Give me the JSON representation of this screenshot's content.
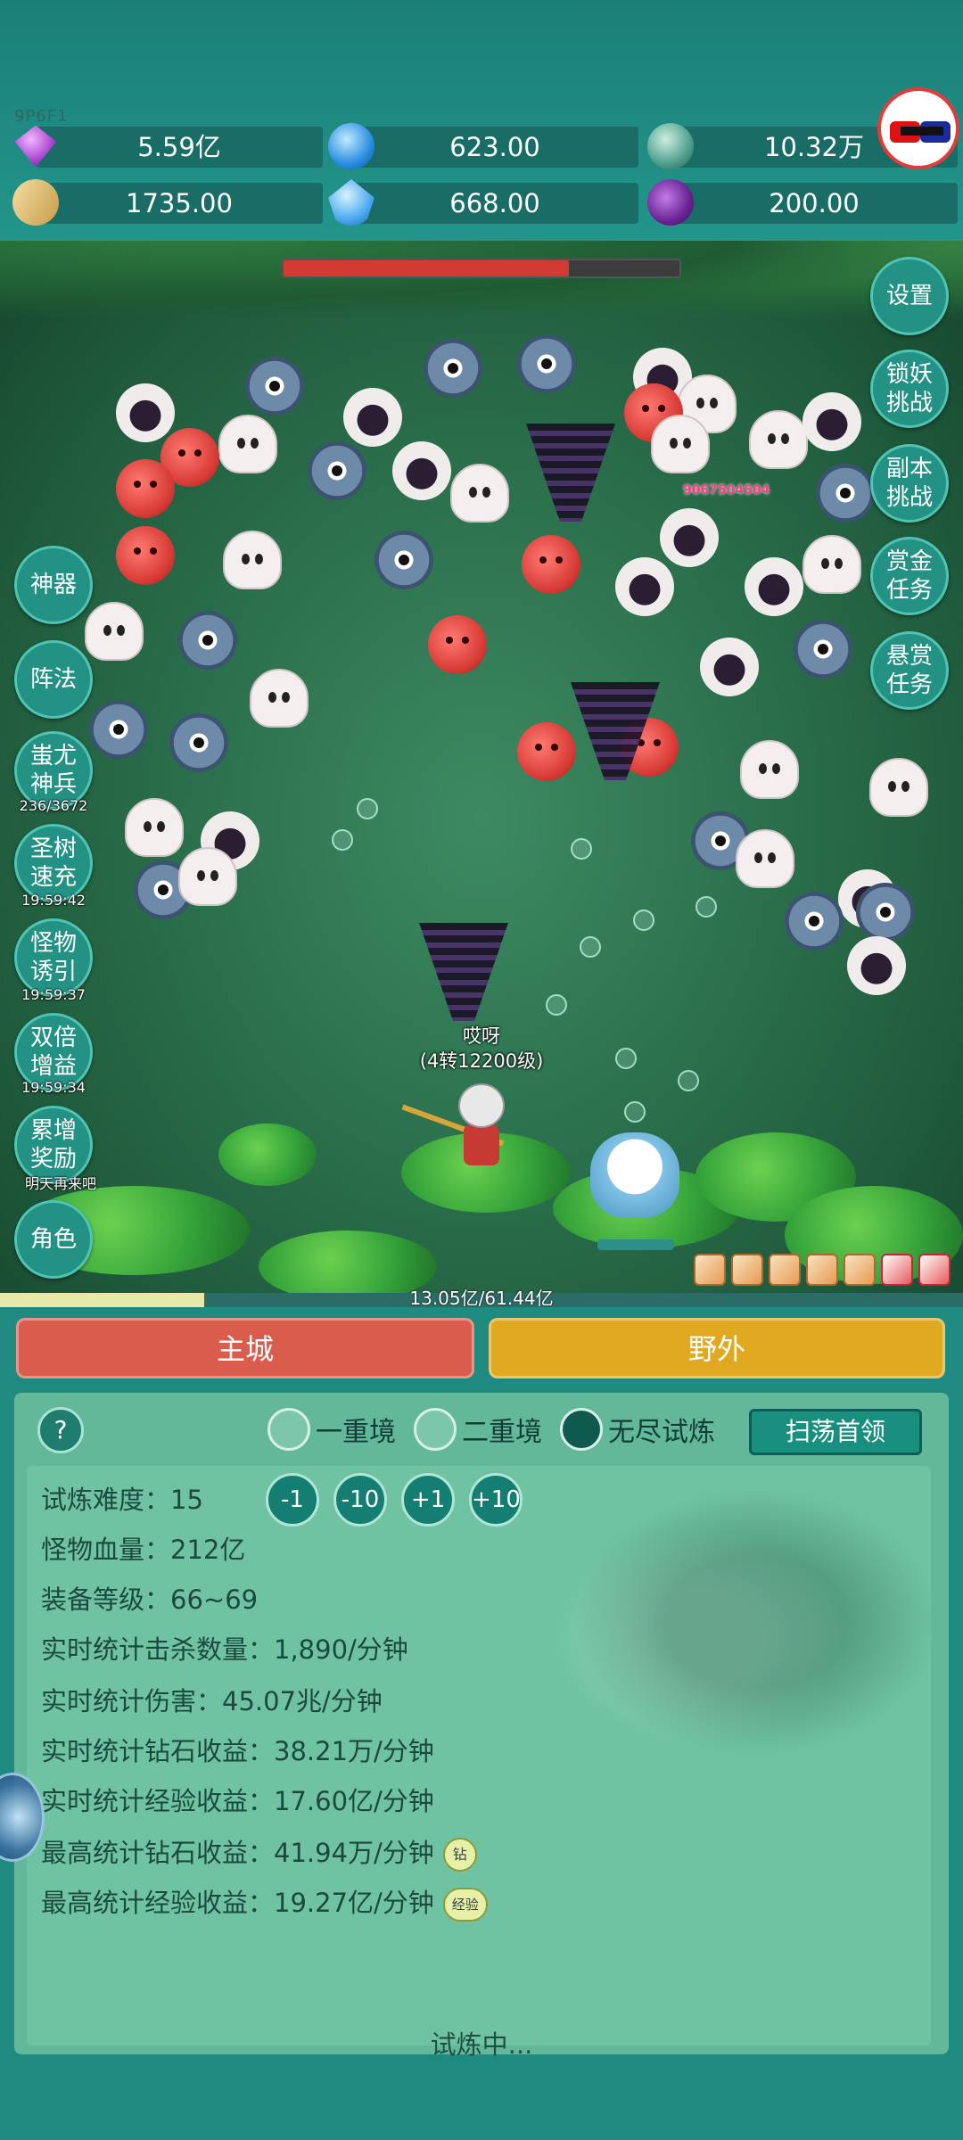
{
  "user_code": "9P6F1",
  "resources": [
    {
      "icon": "diamond-icon",
      "value": "5.59亿"
    },
    {
      "icon": "sapphire-icon",
      "value": "623.00"
    },
    {
      "icon": "orb-icon",
      "value": "10.32万"
    },
    {
      "icon": "scroll-icon",
      "value": "1735.00"
    },
    {
      "icon": "crystal-icon",
      "value": "668.00"
    },
    {
      "icon": "potion-pot-icon",
      "value": "200.00"
    }
  ],
  "boss_hp_fraction": 0.72,
  "left_menu": [
    {
      "label": "神器",
      "sub": ""
    },
    {
      "label": "阵法",
      "sub": ""
    },
    {
      "label": "蚩尤神兵",
      "sub": "236/3672"
    },
    {
      "label": "圣树速充",
      "sub": "19:59:42"
    },
    {
      "label": "怪物诱引",
      "sub": "19:59:37"
    },
    {
      "label": "双倍增益",
      "sub": "19:59:34"
    },
    {
      "label": "累增奖励",
      "sub": "明天再来吧"
    },
    {
      "label": "角色",
      "sub": ""
    }
  ],
  "right_menu": [
    {
      "label": "设置"
    },
    {
      "label": "锁妖挑战"
    },
    {
      "label": "副本挑战"
    },
    {
      "label": "赏金任务"
    },
    {
      "label": "悬赏任务"
    }
  ],
  "damage_number": "9067504504",
  "player": {
    "name": "哎呀",
    "level": "(4转12200级)"
  },
  "exp": {
    "text": "13.05亿/61.44亿",
    "fraction": 0.2124
  },
  "tabs": {
    "city": "主城",
    "wild": "野外"
  },
  "panel": {
    "help": "?",
    "modes": [
      {
        "label": "一重境",
        "selected": false
      },
      {
        "label": "二重境",
        "selected": false
      },
      {
        "label": "无尽试炼",
        "selected": true
      }
    ],
    "sweep_button": "扫荡首领",
    "difficulty_label": "试炼难度：15",
    "adjust_buttons": [
      "-1",
      "-10",
      "+1",
      "+10"
    ],
    "stats": [
      "怪物血量：212亿",
      "装备等级：66~69",
      "实时统计击杀数量：1,890/分钟",
      "实时统计伤害：45.07兆/分钟",
      "实时统计钻石收益：38.21万/分钟",
      "实时统计经验收益：17.60亿/分钟",
      "最高统计钻石收益：41.94万/分钟",
      "最高统计经验收益：19.27亿/分钟"
    ],
    "badge_diamond": "钻",
    "badge_exp": "经验",
    "status": "试炼中..."
  },
  "colors": {
    "boss_hp": "#d23a32",
    "city_tab": "#d95c4c",
    "wild_tab": "#e1a822",
    "panel_bg": "#62b899"
  }
}
